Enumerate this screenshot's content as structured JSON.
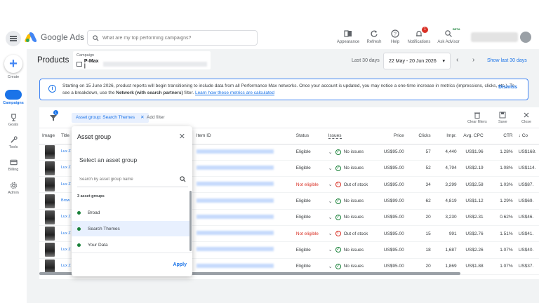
{
  "header": {
    "app_name": "Google Ads",
    "search_placeholder": "What are my top performing campaigns?",
    "tools": {
      "appearance": "Appearance",
      "refresh": "Refresh",
      "help": "Help",
      "notifications": "Notifications",
      "notifications_count": "1",
      "ask_advisor": "Ask Advisor",
      "beta": "BETA"
    }
  },
  "leftnav": {
    "create": "Create",
    "campaigns": "Campaigns",
    "goals": "Goals",
    "tools": "Tools",
    "billing": "Billing",
    "admin": "Admin"
  },
  "page": {
    "title": "Products",
    "campaign_label": "Campaign",
    "campaign_value": "P-Max |",
    "date_label": "Last 30 days",
    "date_range": "22 May - 20 Jun 2026",
    "show_link": "Show last 30 days"
  },
  "banner": {
    "text_1": "Starting on 15 June 2026, product reports will begin transitioning to include data from all Performance Max networks. Once your account is updated, you may notice a one-time increase in metrics (impressions, clicks, etc.). To see a breakdown, use the ",
    "bold": "Network (with search partners)",
    "text_2": " filter. ",
    "link": "Learn how these metrics are calculated",
    "dismiss": "Dismiss"
  },
  "filters": {
    "badge": "1",
    "chip": "Asset group: Search Themes",
    "add_filter": "Add filter",
    "clear": "Clear filters",
    "save": "Save",
    "close": "Close"
  },
  "table": {
    "headers": {
      "image": "Image",
      "title": "Title",
      "item_id": "Item ID",
      "status": "Status",
      "issues": "Issues",
      "price": "Price",
      "clicks": "Clicks",
      "impr": "Impr.",
      "avg_cpc": "Avg. CPC",
      "ctr": "CTR",
      "cost": "Co"
    },
    "rows": [
      {
        "title": "Lux Z Equa",
        "status": "Eligible",
        "issue": "No issues",
        "price": "US$95.00",
        "clicks": "57",
        "impr": "4,440",
        "cpc": "US$1.96",
        "ctr": "1.28%",
        "cost": "US$168."
      },
      {
        "title": "Lux Z Equa",
        "status": "Eligible",
        "issue": "No issues",
        "price": "US$95.00",
        "clicks": "52",
        "impr": "4,794",
        "cpc": "US$2.19",
        "ctr": "1.08%",
        "cost": "US$114."
      },
      {
        "title": "Lux Z Equa",
        "status": "Not eligible",
        "issue": "Out of stock",
        "price": "US$95.00",
        "clicks": "34",
        "impr": "3,299",
        "cpc": "US$2.58",
        "ctr": "1.03%",
        "cost": "US$87."
      },
      {
        "title": "Brow Wom Lux",
        "status": "Eligible",
        "issue": "No issues",
        "price": "US$99.00",
        "clicks": "62",
        "impr": "4,819",
        "cpc": "US$1.12",
        "ctr": "1.29%",
        "cost": "US$69."
      },
      {
        "title": "Lux Z Equa",
        "status": "Eligible",
        "issue": "No issues",
        "price": "US$95.00",
        "clicks": "20",
        "impr": "3,230",
        "cpc": "US$2.31",
        "ctr": "0.62%",
        "cost": "US$46."
      },
      {
        "title": "Lux Z Brow",
        "status": "Not eligible",
        "issue": "Out of stock",
        "price": "US$95.00",
        "clicks": "15",
        "impr": "991",
        "cpc": "US$2.76",
        "ctr": "1.51%",
        "cost": "US$41."
      },
      {
        "title": "Lux Z Equa",
        "status": "Eligible",
        "issue": "No issues",
        "price": "US$95.00",
        "clicks": "18",
        "impr": "1,687",
        "cpc": "US$2.26",
        "ctr": "1.07%",
        "cost": "US$40."
      },
      {
        "title": "Lux Z Equa",
        "status": "Eligible",
        "issue": "No issues",
        "price": "US$95.00",
        "clicks": "20",
        "impr": "1,869",
        "cpc": "US$1.88",
        "ctr": "1.07%",
        "cost": "US$37."
      }
    ]
  },
  "popup": {
    "title": "Asset group",
    "subtitle": "Select an asset group",
    "search_placeholder": "Search by asset group name",
    "count": "3 asset groups",
    "items": [
      "Broad",
      "Search Themes",
      "Your Data"
    ],
    "apply": "Apply"
  }
}
